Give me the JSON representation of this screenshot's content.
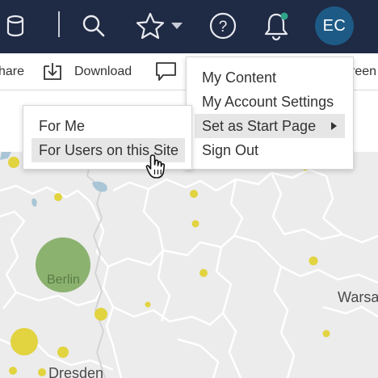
{
  "topbar": {
    "icons": [
      "database-icon",
      "search-icon",
      "star-icon",
      "chevron-down-icon",
      "help-icon",
      "notification-bell-icon"
    ],
    "avatar_initials": "EC",
    "notification_dot_color": "#2fa58a",
    "background_color": "#1f2a44"
  },
  "toolbar": {
    "share_label": "hare",
    "download_label": "Download",
    "fullscreen_label": "reen"
  },
  "account_menu": {
    "items": [
      "My Content",
      "My Account Settings",
      "Set as Start Page",
      "Sign Out"
    ],
    "highlighted_item": "Set as Start Page"
  },
  "start_page_submenu": {
    "items": [
      "For Me",
      "For Users on this Site"
    ],
    "highlighted_item": "For Users on this Site"
  },
  "map": {
    "city_labels": [
      "Berlin",
      "Dresden",
      "Warsa"
    ],
    "dot_color": "#e2d340",
    "large_circle_color": "#7ba85a"
  }
}
